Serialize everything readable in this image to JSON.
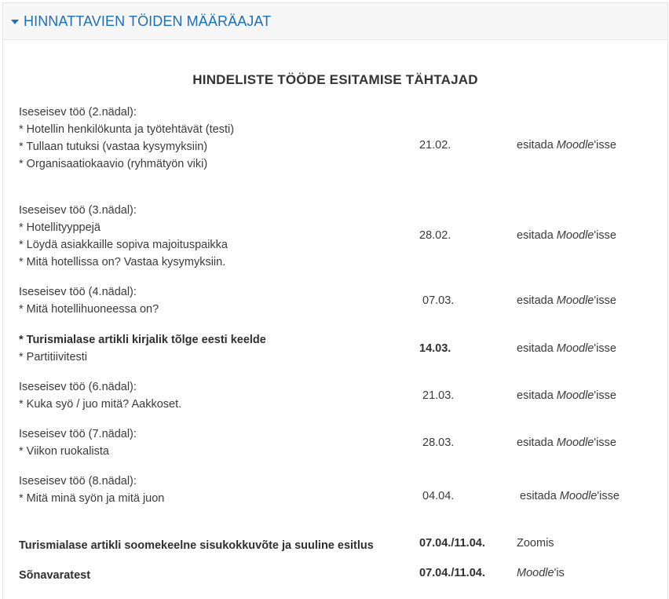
{
  "section": {
    "title": "HINNATTAVIEN TÖIDEN MÄÄRÄAJAT"
  },
  "table": {
    "title": "HINDELISTE TÖÖDE ESITAMISE TÄHTAJAD",
    "rows": [
      {
        "lines": [
          "Iseseisev töö (2.nädal):",
          "* Hotellin henkilökunta ja työtehtävät (testi)",
          "* Tullaan tutuksi (vastaa kysymyksiin)",
          "* Organisaatiokaavio (ryhmätyön viki)"
        ],
        "date": "21.02.",
        "where_prefix": "esitada ",
        "where_em": "Moodle",
        "where_suffix": "'isse"
      },
      {
        "lines": [
          "Iseseisev töö (3.nädal):",
          "* Hotellityyppejä",
          "* Löydä asiakkaille sopiva majoituspaikka",
          "* Mitä hotellissa on? Vastaa kysymyksiin."
        ],
        "date": "28.02.",
        "where_prefix": "esitada ",
        "where_em": "Moodle",
        "where_suffix": "'isse"
      },
      {
        "lines": [
          "Iseseisev töö (4.nädal):",
          "* Mitä hotellihuoneessa on?"
        ],
        "date": "07.03.",
        "where_prefix": "esitada ",
        "where_em": "Moodle",
        "where_suffix": "'isse"
      },
      {
        "lines": [
          "* Turismialase artikli kirjalik tõlge eesti keelde",
          "* Partitiivitesti"
        ],
        "date": "14.03.",
        "where_prefix": "esitada ",
        "where_em": "Moodle",
        "where_suffix": "'isse"
      },
      {
        "lines": [
          "Iseseisev töö (6.nädal):",
          "* Kuka syö / juo mitä? Aakkoset."
        ],
        "date": "21.03.",
        "where_prefix": "esitada ",
        "where_em": "Moodle",
        "where_suffix": "'isse"
      },
      {
        "lines": [
          "Iseseisev töö (7.nädal):",
          "* Viikon ruokalista"
        ],
        "date": "28.03.",
        "where_prefix": "esitada ",
        "where_em": "Moodle",
        "where_suffix": "'isse"
      },
      {
        "lines": [
          "Iseseisev töö (8.nädal):",
          "* Mitä minä syön ja mitä juon"
        ],
        "date": "04.04.",
        "where_prefix": "esitada ",
        "where_em": "Moodle",
        "where_suffix": "'isse"
      },
      {
        "lines": [
          "Turismialase artikli soomekeelne sisukokkuvõte ja suuline esitlus"
        ],
        "date": "07.04./11.04.",
        "where_prefix": "Zoomis",
        "where_em": "",
        "where_suffix": ""
      },
      {
        "lines": [
          "Sõnavaratest"
        ],
        "date": "07.04./11.04.",
        "where_prefix": "",
        "where_em": "Moodle",
        "where_suffix": "'is"
      }
    ]
  }
}
